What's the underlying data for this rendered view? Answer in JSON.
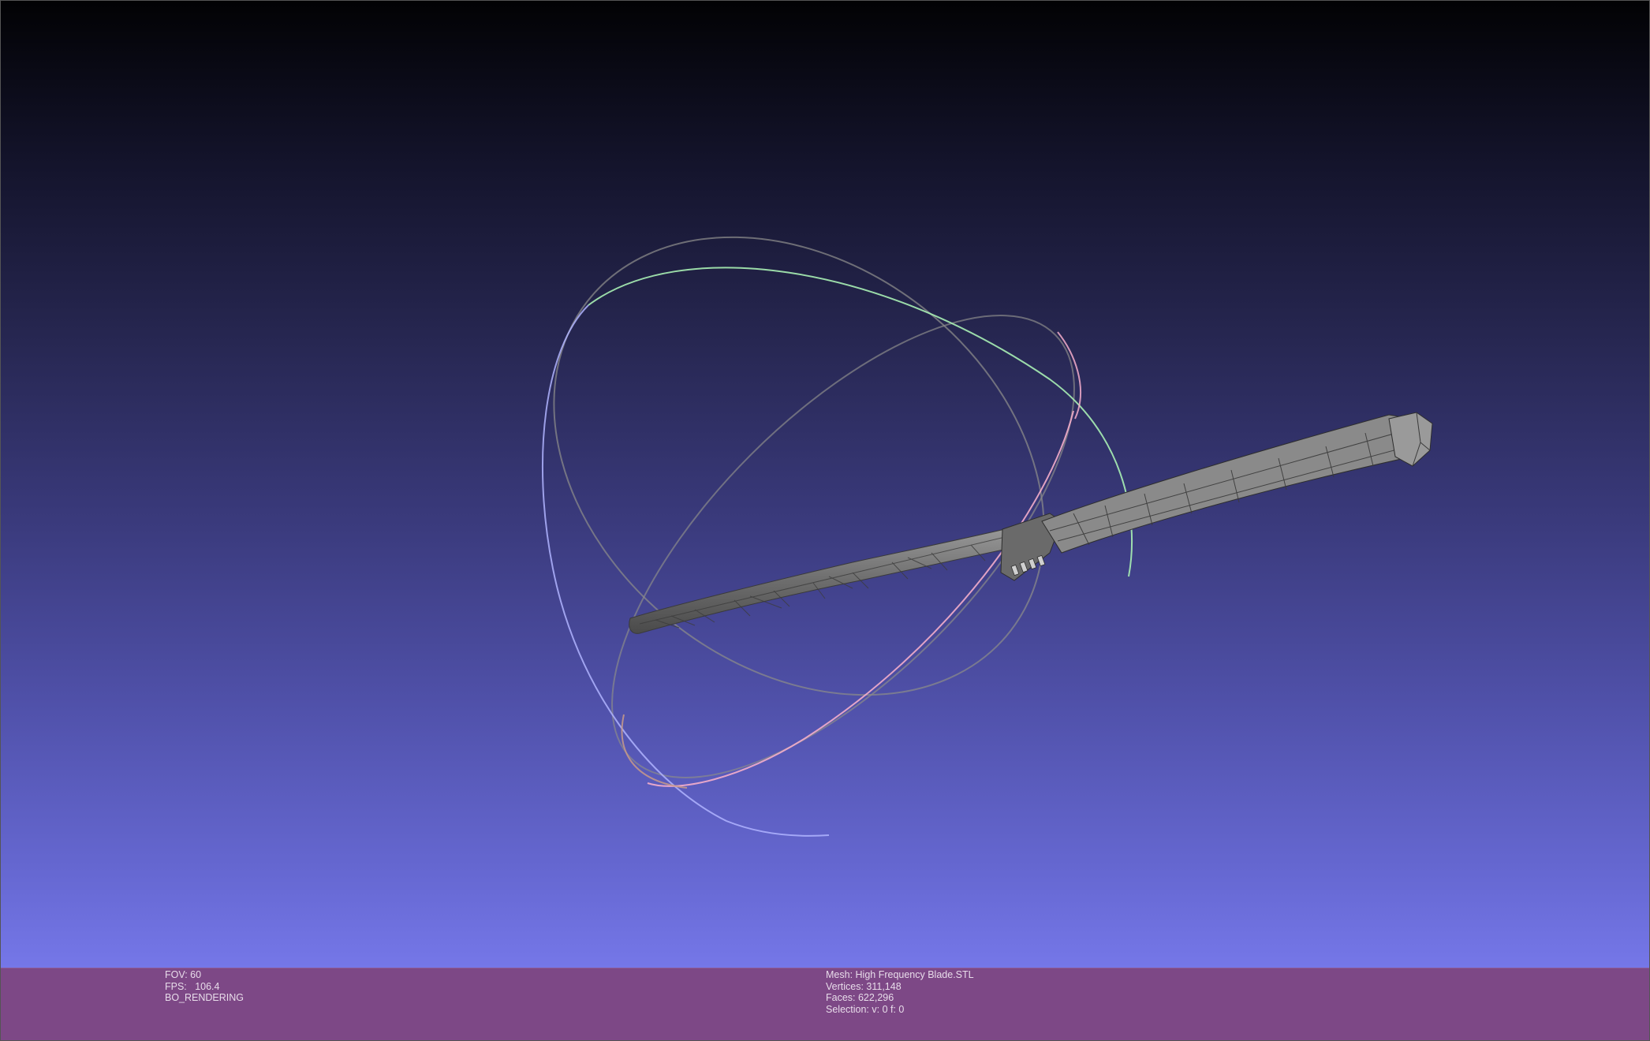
{
  "window": {
    "background_top": "#020204",
    "background_bottom": "#7577e8",
    "info_bar_color": "#7d4886"
  },
  "info_left": {
    "fov": "FOV: 60",
    "fps": "FPS:   106.4",
    "mode": "BO_RENDERING"
  },
  "info_mesh": {
    "mesh": "Mesh: High Frequency Blade.STL",
    "vertices": "Vertices: 311,148",
    "faces": "Faces: 622,296",
    "selection": "Selection: v: 0 f: 0"
  },
  "trackball": {
    "ring_colors": [
      "#8c8c8c",
      "#9bf0a8",
      "#f0a8c0",
      "#a8acf8"
    ]
  },
  "model": {
    "icon": "sword-mesh",
    "color": "#7a7a7a"
  }
}
